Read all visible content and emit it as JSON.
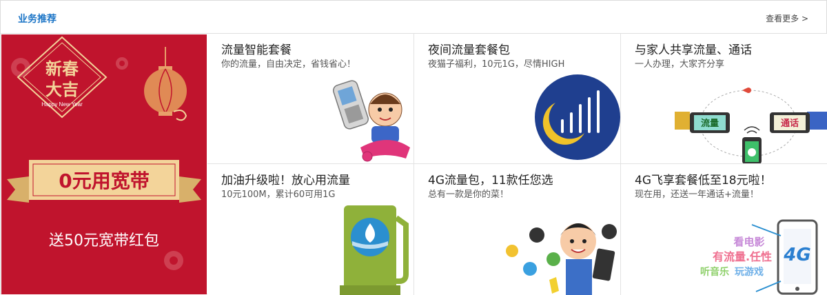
{
  "section": {
    "title": "业务推荐",
    "more_label": "查看更多 >"
  },
  "banner": {
    "seal_line1": "新春",
    "seal_line2": "大吉",
    "seal_sub": "Happy New Year",
    "ribbon_text": "0元用宽带",
    "bottom_text": "送50元宽带红包"
  },
  "cards": [
    {
      "title": "流量智能套餐",
      "desc": "你的流量，自由决定，省钱省心！"
    },
    {
      "title": "夜间流量套餐包",
      "desc": "夜猫子福利，10元1G，尽情HIGH"
    },
    {
      "title": "与家人共享流量、通话",
      "desc": "一人办理，大家齐分享",
      "tag_left": "流量",
      "tag_right": "通话"
    },
    {
      "title": "加油升级啦！放心用流量",
      "desc": "10元100M，累计60可用1G"
    },
    {
      "title": "4G流量包，11款任您选",
      "desc": "总有一款是你的菜！"
    },
    {
      "title": "4G飞享套餐低至18元啦！",
      "desc": "现在用，还送一年通话+流量！",
      "art_line1": "看电影",
      "art_line2": "有流量.任性",
      "art_line3a": "听音乐",
      "art_line3b": "玩游戏",
      "art_badge": "4G"
    }
  ],
  "colors": {
    "accent": "#1a74c6",
    "banner_red": "#c0142d",
    "gold": "#f3d49a",
    "moon_blue": "#1f3f8f",
    "fuel_green": "#8fb13a"
  }
}
